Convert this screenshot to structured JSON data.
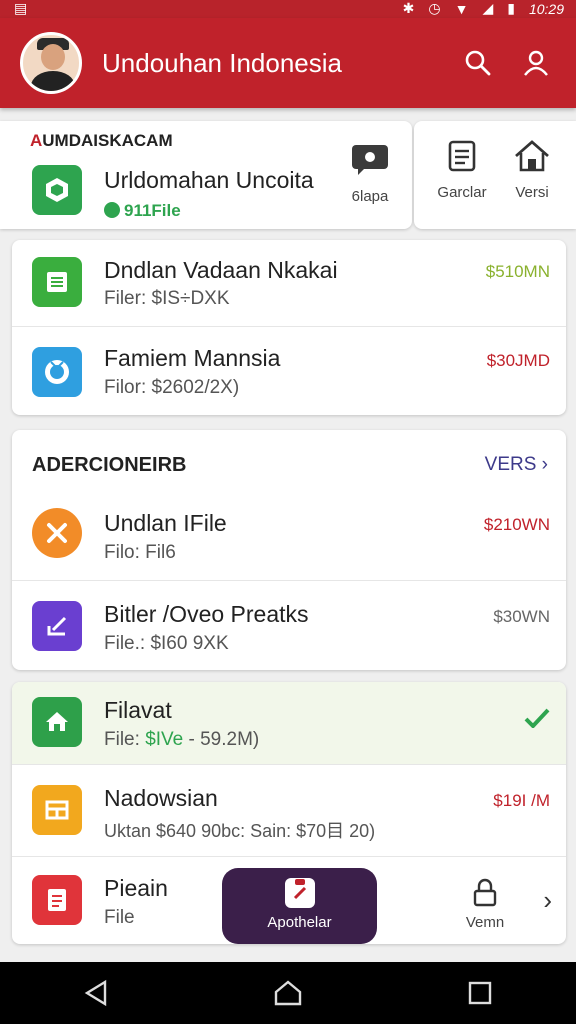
{
  "statusbar": {
    "time": "10:29"
  },
  "appbar": {
    "title": "Undouhan Indonesia"
  },
  "featured": {
    "category": "UMDAISKACAM",
    "title": "Urldomahan Uncoita",
    "badge": "911File",
    "action_label": "6lapa"
  },
  "side_actions": [
    {
      "label": "Garclar"
    },
    {
      "label": "Versi"
    }
  ],
  "list1": [
    {
      "name": "Dndlan Vadaan Nkakai",
      "sub": "Filer: $IS÷DXK",
      "price": "$510MN",
      "price_color": "#8ab12e",
      "tile_color": "#3aae3e"
    },
    {
      "name": "Famiem Mannsia",
      "sub": "Filor: $2602/2X)",
      "price": "$30JMD",
      "price_color": "#c0222b",
      "tile_color": "#2f9fe0"
    }
  ],
  "section": {
    "title": "ADERCIONEIRB",
    "link": "VERS"
  },
  "list2": [
    {
      "name": "Undlan IFile",
      "sub": "Filo: Fil6",
      "price": "$210WN",
      "price_color": "#c0222b",
      "tile_color": "#f28c28"
    },
    {
      "name": "Bitler /Oveo Preatks",
      "sub": "File.: $I60 9XK",
      "price": "$30WN",
      "price_color": "#666666",
      "tile_color": "#6a3fd0"
    }
  ],
  "list3": [
    {
      "name": "Filavat",
      "sub_prefix": "File: ",
      "sub_highlight": "$IVe",
      "sub_suffix": " - 59.2M)",
      "tile_color": "#2ea04a"
    },
    {
      "name": "Nadowsian",
      "sub": "Uktan $640 90bc: Sain: $70目 20)",
      "price": "$19I /M",
      "price_color": "#c0222b",
      "tile_color": "#f2a81e"
    },
    {
      "name": "Pieain",
      "sub": "File",
      "tile_color": "#e0343a",
      "action_label": "Vemn"
    }
  ],
  "fab": {
    "label": "Apothelar"
  },
  "colors": {
    "primary": "#c0222b",
    "fab": "#3b1f4a",
    "success": "#2ea44f"
  }
}
